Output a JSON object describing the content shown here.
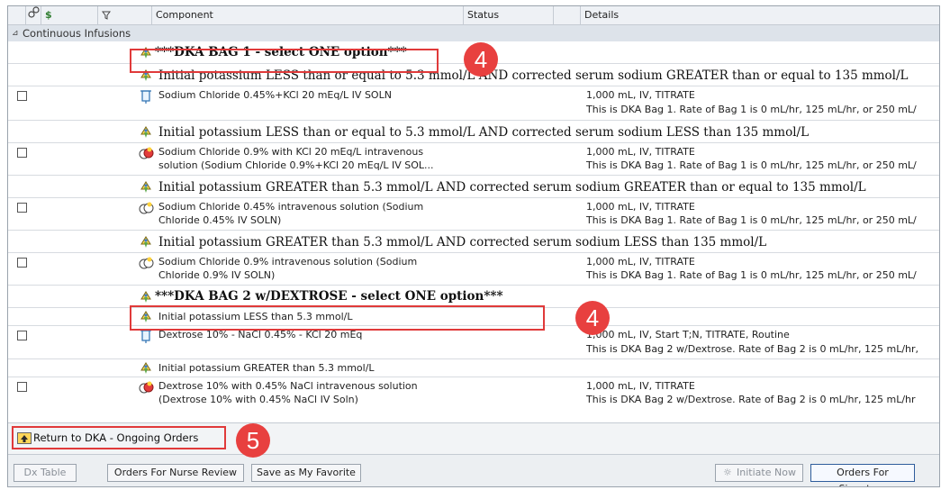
{
  "header": {
    "col_component": "Component",
    "col_status": "Status",
    "col_details": "Details",
    "col_icon1": "link-icon",
    "col_icon2": "$",
    "col_icon3": "filter-icon"
  },
  "group": {
    "toggle": "⊿",
    "label": "Continuous Infusions"
  },
  "rows": [
    {
      "kind": "section",
      "text": "***DKA BAG 1 - select ONE option***"
    },
    {
      "kind": "sub",
      "text": "Initial potassium LESS than or equal to 5.3 mmol/L AND corrected serum sodium GREATER than or equal to 135 mmol/L"
    },
    {
      "kind": "order",
      "comp1": "Sodium Chloride 0.45%+KCl 20 mEq/L IV SOLN",
      "comp2": "",
      "det1": "1,000 mL, IV, TITRATE",
      "det2": "This is DKA Bag 1. Rate of Bag 1 is 0 mL/hr, 125 mL/hr, or 250 mL/"
    },
    {
      "kind": "sub",
      "text": "Initial potassium LESS than or equal to 5.3 mmol/L AND corrected serum sodium LESS than 135 mmol/L"
    },
    {
      "kind": "order",
      "comp1": "Sodium Chloride 0.9% with KCl 20 mEq/L intravenous",
      "comp2": "solution (Sodium Chloride 0.9%+KCl 20 mEq/L IV SOL...",
      "det1": "1,000 mL, IV, TITRATE",
      "det2": "This is DKA Bag 1. Rate of Bag 1 is 0 mL/hr, 125 mL/hr, or 250 mL/"
    },
    {
      "kind": "sub",
      "text": "Initial potassium GREATER than 5.3 mmol/L AND corrected serum sodium GREATER than or equal to 135 mmol/L"
    },
    {
      "kind": "order",
      "comp1": "Sodium Chloride 0.45% intravenous solution (Sodium",
      "comp2": "Chloride 0.45% IV SOLN)",
      "det1": "1,000 mL, IV, TITRATE",
      "det2": "This is DKA Bag 1. Rate of Bag 1 is 0 mL/hr, 125 mL/hr, or 250 mL/"
    },
    {
      "kind": "sub",
      "text": "Initial potassium GREATER than 5.3 mmol/L AND corrected serum sodium LESS than 135 mmol/L"
    },
    {
      "kind": "order",
      "comp1": "Sodium Chloride 0.9% intravenous solution (Sodium",
      "comp2": "Chloride 0.9% IV SOLN)",
      "det1": "1,000 mL, IV, TITRATE",
      "det2": "This is DKA Bag 1. Rate of Bag 1 is 0 mL/hr, 125 mL/hr, or 250 mL/"
    },
    {
      "kind": "section",
      "text": "***DKA BAG 2 w/DEXTROSE - select ONE option***"
    },
    {
      "kind": "sub",
      "text": "Initial potassium LESS than 5.3 mmol/L"
    },
    {
      "kind": "order",
      "comp1": "Dextrose 10% - NaCl 0.45% - KCl 20 mEq",
      "comp2": "",
      "det1": "1,000 mL, IV, Start T;N, TITRATE, Routine",
      "det2": "This is DKA Bag 2 w/Dextrose. Rate of Bag 2 is 0 mL/hr, 125 mL/hr,"
    },
    {
      "kind": "sub",
      "text": "Initial potassium GREATER than 5.3 mmol/L"
    },
    {
      "kind": "order",
      "comp1": "Dextrose 10% with 0.45% NaCl intravenous solution",
      "comp2": "(Dextrose 10% with 0.45% NaCl IV Soln)",
      "det1": "1,000 mL, IV, TITRATE",
      "det2": "This is DKA Bag 2 w/Dextrose. Rate of Bag 2 is 0 mL/hr, 125 mL/hr"
    }
  ],
  "return_button": "Return to DKA - Ongoing Orders",
  "callouts": {
    "c1": "4",
    "c2": "4",
    "c3": "5"
  },
  "buttons": {
    "dx_table": "Dx Table",
    "nurse_review": "Orders For Nurse Review",
    "favorite": "Save as My Favorite",
    "initiate": "Initiate Now",
    "signature": "Orders For Signature"
  },
  "colors": {
    "callout": "#e8403f",
    "highlight_border": "#e03a3a"
  }
}
